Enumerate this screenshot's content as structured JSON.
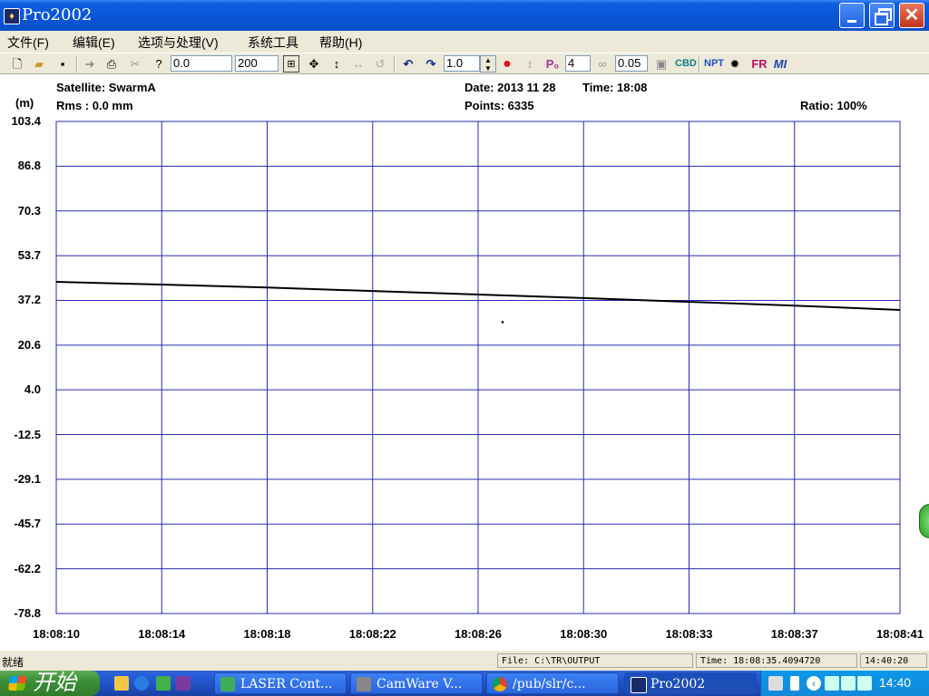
{
  "window": {
    "title": "Pro2002"
  },
  "menu": [
    {
      "label": "文件(F)"
    },
    {
      "label": "编辑(E)"
    },
    {
      "label": "选项与处理(V)"
    },
    {
      "label": "系统工具"
    },
    {
      "label": "帮助(H)"
    }
  ],
  "toolbar": {
    "range_start": "0.0",
    "range_end": "200",
    "step": "1.0",
    "p_value": "4",
    "threshold": "0.05"
  },
  "header": {
    "satellite": "Satellite: SwarmA",
    "rms": "Rms :   0.0 mm",
    "date": "Date: 2013 11 28",
    "time": "Time: 18:08",
    "points": "Points:  6335",
    "ratio": "Ratio: 100%",
    "unit": "(m)"
  },
  "chart_data": {
    "type": "scatter",
    "ylabel": "(m)",
    "yticks": [
      "103.4",
      "86.8",
      "70.3",
      "53.7",
      "37.2",
      "20.6",
      "4.0",
      "-12.5",
      "-29.1",
      "-45.7",
      "-62.2",
      "-78.8"
    ],
    "xticks": [
      "18:08:10",
      "18:08:14",
      "18:08:18",
      "18:08:22",
      "18:08:26",
      "18:08:30",
      "18:08:33",
      "18:08:37",
      "18:08:41"
    ],
    "ylim": [
      -78.8,
      103.4
    ],
    "grid": true,
    "trend": [
      {
        "t": "18:08:10",
        "y": 44.0
      },
      {
        "t": "18:08:14",
        "y": 43.0
      },
      {
        "t": "18:08:18",
        "y": 41.9
      },
      {
        "t": "18:08:22",
        "y": 40.6
      },
      {
        "t": "18:08:26",
        "y": 39.3
      },
      {
        "t": "18:08:30",
        "y": 38.0
      },
      {
        "t": "18:08:33",
        "y": 36.6
      },
      {
        "t": "18:08:37",
        "y": 35.2
      },
      {
        "t": "18:08:41",
        "y": 33.6
      }
    ],
    "outliers": [
      {
        "t": "18:08:26.4",
        "y": 29.1
      }
    ]
  },
  "status": {
    "left": "就绪",
    "file": "File: C:\\TR\\OUTPUT",
    "time": "Time: 18:08:35.4094720",
    "clock": "14:40:20"
  },
  "taskbar": {
    "start": "开始",
    "tasks": [
      {
        "label": "LASER Cont..."
      },
      {
        "label": "CamWare  V..."
      },
      {
        "label": "/pub/slr/c..."
      },
      {
        "label": "Pro2002"
      }
    ],
    "clock": "14:40"
  }
}
